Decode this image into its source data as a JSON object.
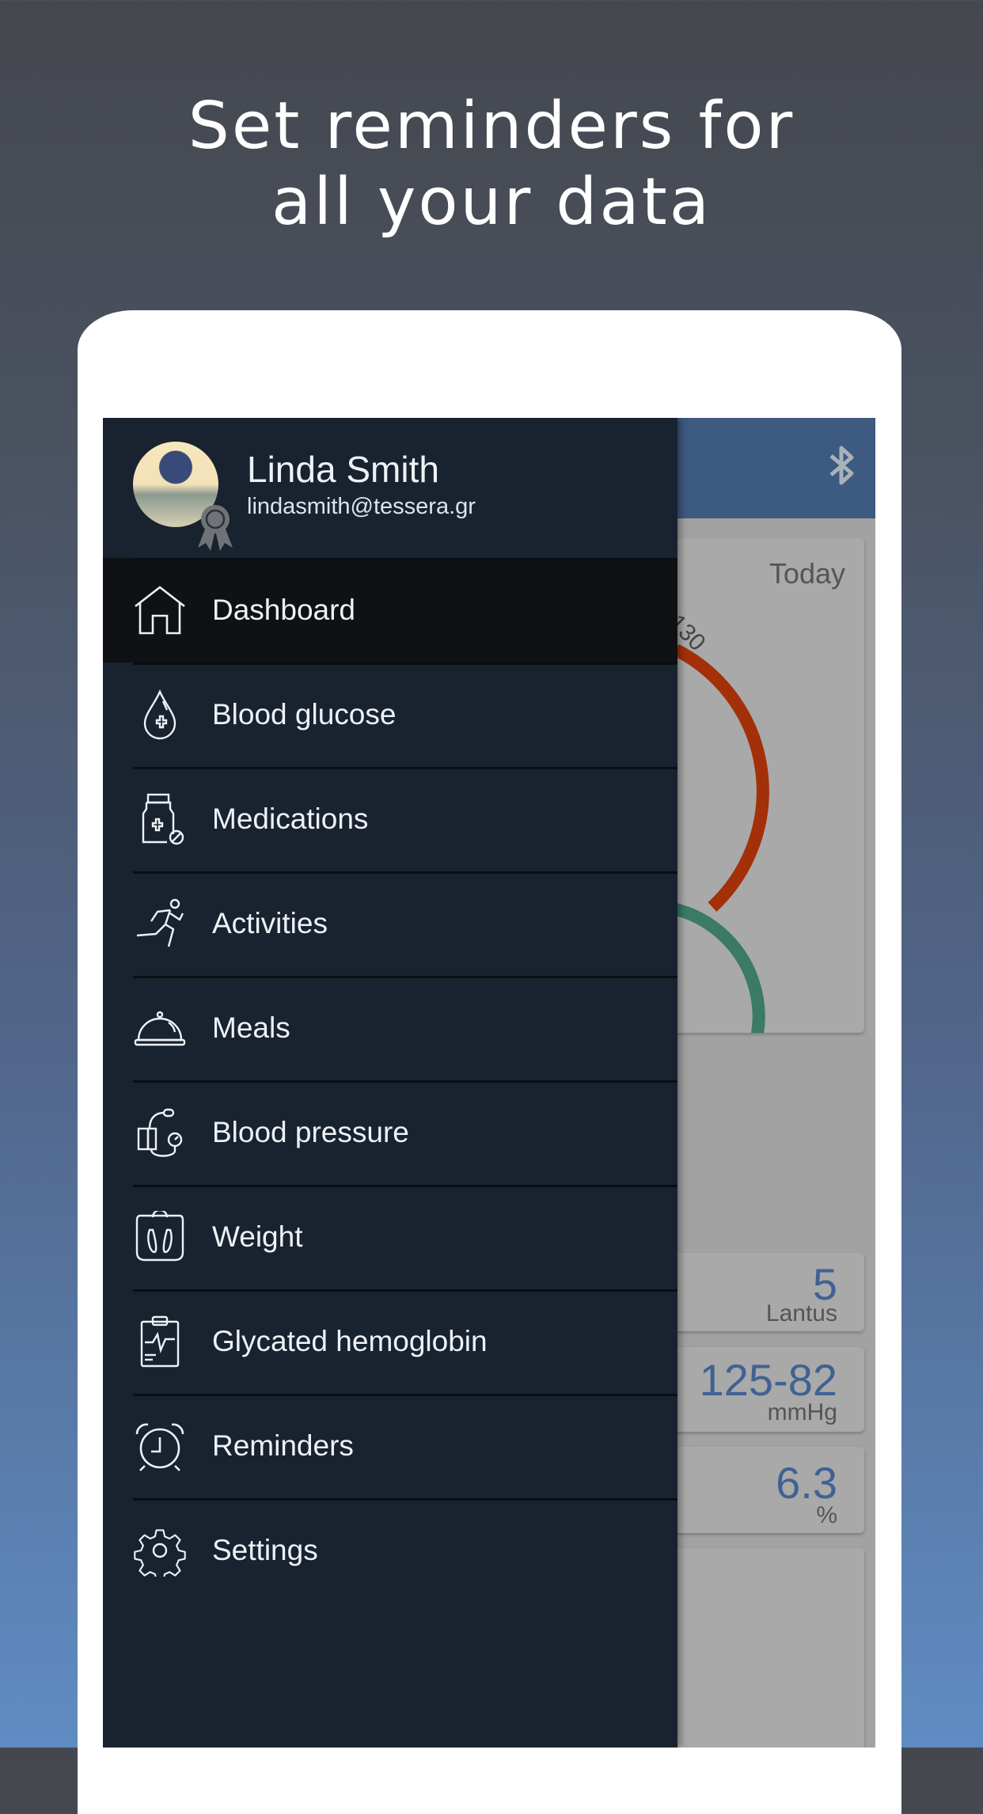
{
  "headline": {
    "line1": "Set reminders for",
    "line2": "all your data"
  },
  "colors": {
    "drawer": "#19222f",
    "selected_row": "#0f1115",
    "app_bar": "#3d5a80",
    "value_blue": "#3f6294",
    "gauge_red": "#a33008",
    "gauge_green": "#3a7a66"
  },
  "profile": {
    "name": "Linda Smith",
    "email": "lindasmith@tessera.gr"
  },
  "menu": {
    "items": [
      {
        "label": "Dashboard",
        "icon": "home-icon",
        "selected": true
      },
      {
        "label": "Blood glucose",
        "icon": "blood-drop-icon"
      },
      {
        "label": "Medications",
        "icon": "pill-bottle-icon"
      },
      {
        "label": "Activities",
        "icon": "running-person-icon"
      },
      {
        "label": "Meals",
        "icon": "food-cloche-icon"
      },
      {
        "label": "Blood pressure",
        "icon": "blood-pressure-cuff-icon"
      },
      {
        "label": "Weight",
        "icon": "scale-icon"
      },
      {
        "label": "Glycated hemoglobin",
        "icon": "clipboard-pulse-icon"
      },
      {
        "label": "Reminders",
        "icon": "alarm-clock-icon"
      },
      {
        "label": "Settings",
        "icon": "gear-icon"
      }
    ]
  },
  "dashboard": {
    "app_bar_icon": "bluetooth-icon",
    "summary_card": {
      "period": "Today",
      "gauge_label": "130"
    },
    "cards": [
      {
        "value": "5",
        "unit": "Lantus"
      },
      {
        "value": "125-82",
        "unit": "mmHg"
      },
      {
        "value": "6.3",
        "unit": "%"
      }
    ]
  }
}
